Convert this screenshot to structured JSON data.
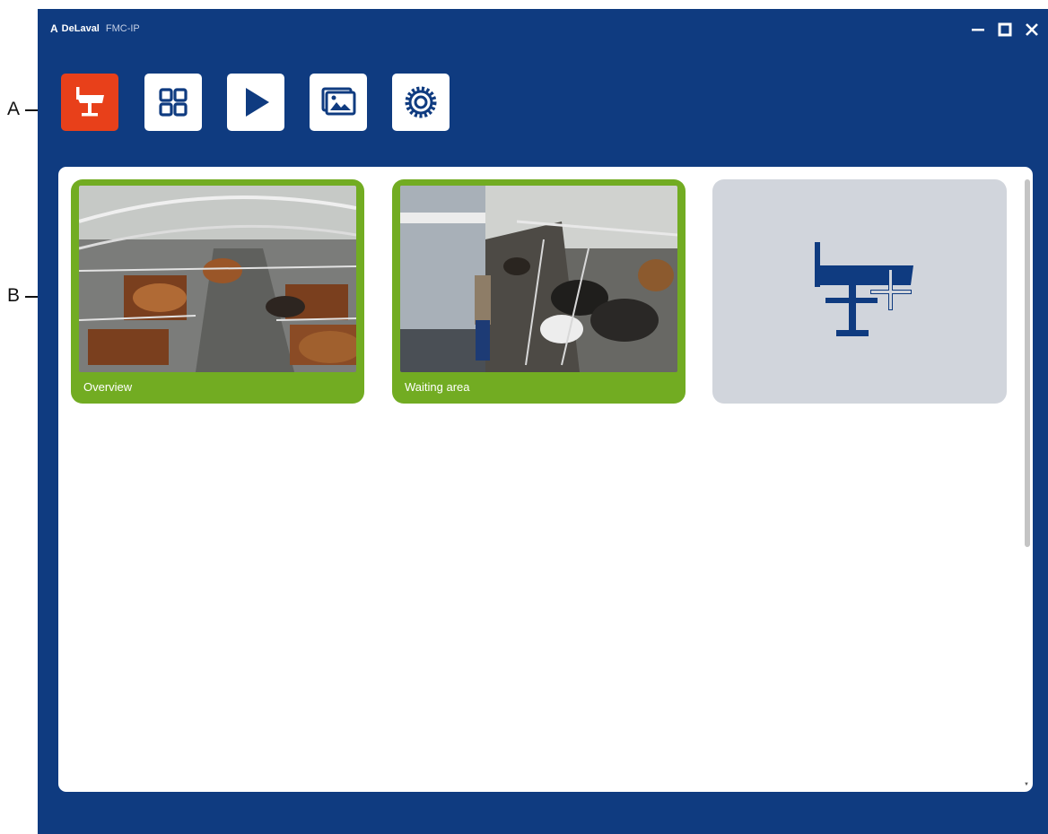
{
  "callouts": {
    "a": "A",
    "b": "B"
  },
  "titlebar": {
    "logo_glyph": "A",
    "brand": "DeLaval",
    "product": "FMC-IP",
    "minimize_icon": "minimize-icon",
    "maximize_icon": "maximize-icon",
    "close_icon": "close-icon"
  },
  "toolbar": {
    "items": [
      {
        "icon": "camera-icon",
        "active": true
      },
      {
        "icon": "grid-icon",
        "active": false
      },
      {
        "icon": "play-icon",
        "active": false
      },
      {
        "icon": "gallery-icon",
        "active": false
      },
      {
        "icon": "settings-gear-icon",
        "active": false
      }
    ]
  },
  "cameras": [
    {
      "label": "Overview"
    },
    {
      "label": "Waiting area"
    }
  ],
  "add_camera": {
    "icon": "add-camera-icon"
  },
  "colors": {
    "window_bg": "#0f3b80",
    "active_button": "#e8401a",
    "camera_frame": "#72ac22",
    "add_tile_bg": "#d1d5dc",
    "icon_blue": "#0f3b80"
  }
}
